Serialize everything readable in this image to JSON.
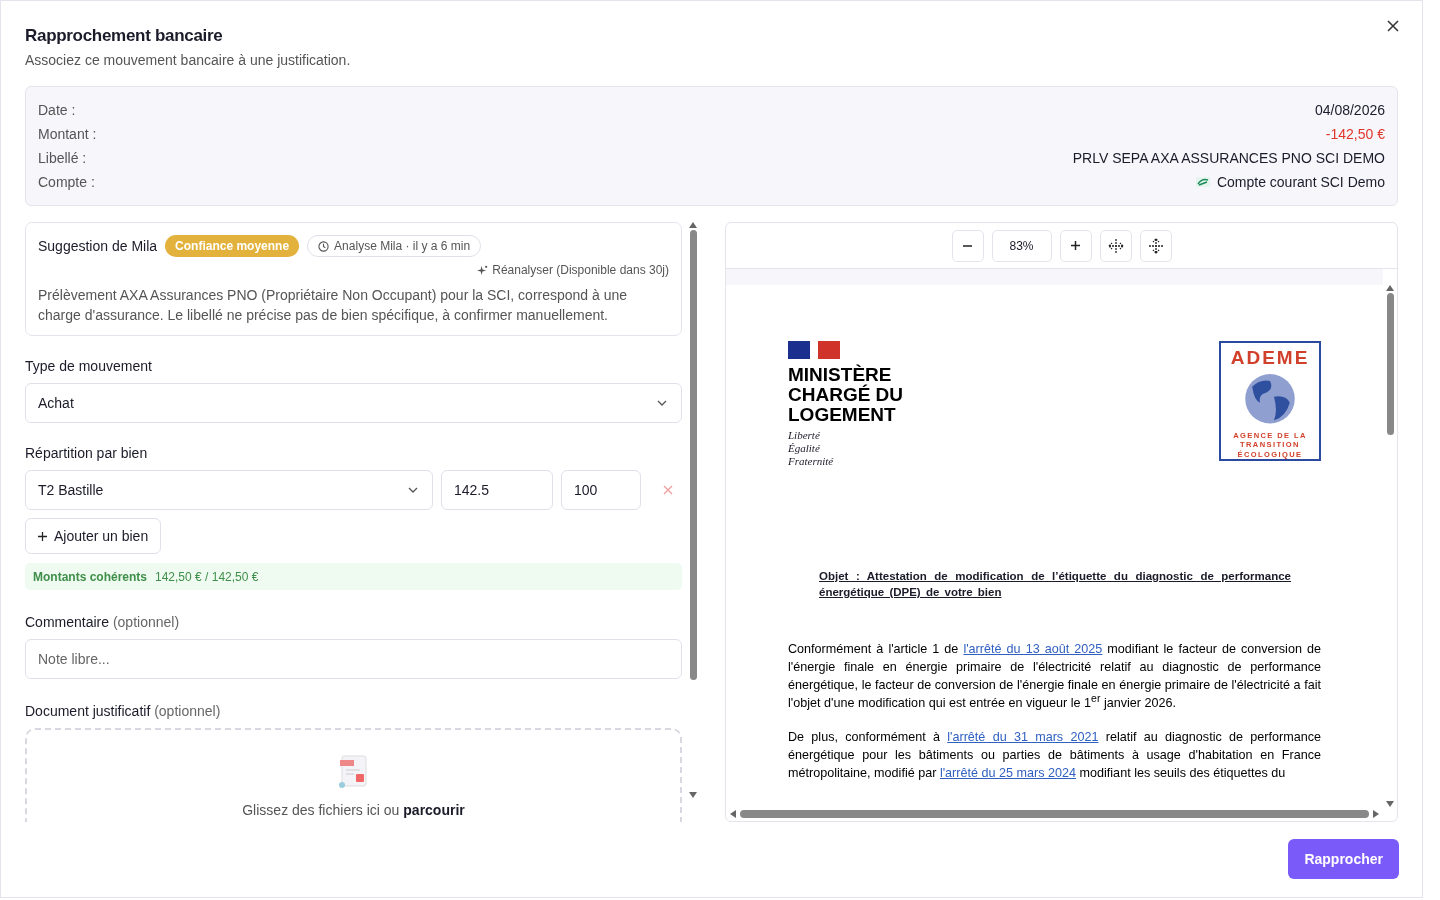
{
  "dialog": {
    "title": "Rapprochement bancaire",
    "subtitle": "Associez ce mouvement bancaire à une justification."
  },
  "transaction": [
    {
      "label": "Date :",
      "value": "04/08/2026",
      "kind": "text"
    },
    {
      "label": "Montant :",
      "value": "-142,50 €",
      "kind": "amount"
    },
    {
      "label": "Libellé :",
      "value": "PRLV SEPA AXA ASSURANCES PNO SCI DEMO",
      "kind": "text"
    },
    {
      "label": "Compte :",
      "value": "Compte courant SCI Demo",
      "kind": "account"
    }
  ],
  "suggestion": {
    "title": "Suggestion de Mila",
    "confidence": "Confiance moyenne",
    "analysis": "Analyse Mila · il y a 6 min",
    "reanalyze": "Réanalyser (Disponible dans 30j)",
    "text": "Prélèvement AXA Assurances PNO (Propriétaire Non Occupant) pour la SCI, correspond à une charge d'assurance. Le libellé ne précise pas de bien spécifique, à confirmer manuellement."
  },
  "movement_type": {
    "label": "Type de mouvement",
    "value": "Achat"
  },
  "allocation": {
    "label": "Répartition par bien",
    "rows": [
      {
        "property": "T2 Bastille",
        "amount": "142.5",
        "percent": "100"
      }
    ],
    "add_button": "Ajouter un bien",
    "status_label": "Montants cohérents",
    "status_value": "142,50 € / 142,50 €"
  },
  "comment": {
    "label": "Commentaire",
    "optional": "(optionnel)",
    "placeholder": "Note libre..."
  },
  "document": {
    "label": "Document justificatif",
    "optional": "(optionnel)",
    "drop_text": "Glissez des fichiers ici ou",
    "browse": "parcourir"
  },
  "viewer": {
    "zoom": "83%",
    "ministry": [
      "MINISTÈRE",
      "CHARGÉ DU",
      "LOGEMENT"
    ],
    "motto": [
      "Liberté",
      "Égalité",
      "Fraternité"
    ],
    "agency": "ADEME",
    "agency_sub": [
      "AGENCE DE LA",
      "TRANSITION",
      "ÉCOLOGIQUE"
    ],
    "subject": "Objet : Attestation de modification de l’étiquette du diagnostic de performance énergétique (DPE) de votre bien",
    "paragraphs": [
      [
        {
          "kind": "text",
          "text": "Conformément à l'article 1 de "
        },
        {
          "kind": "link",
          "text": "l'arrêté du 13 août 2025"
        },
        {
          "kind": "text",
          "text": " modifiant le facteur de conversion de l'énergie finale en énergie primaire de l'électricité relatif au diagnostic de performance énergétique, le facteur de conversion de l'énergie finale en énergie primaire de l'électricité a fait l'objet d'une modification qui est entrée en vigueur le 1$^{er}$ janvier 2026."
        }
      ],
      [
        {
          "kind": "text",
          "text": "De plus, conformément à "
        },
        {
          "kind": "link",
          "text": "l'arrêté du 31 mars 2021"
        },
        {
          "kind": "text",
          "text": " relatif au diagnostic de performance énergétique pour les bâtiments ou parties de bâtiments à usage d'habitation en France métropolitaine, modifié par "
        },
        {
          "kind": "link",
          "text": "l'arrêté du 25 mars 2024"
        },
        {
          "kind": "text",
          "text": " modifiant les seuils des étiquettes du"
        }
      ]
    ]
  },
  "submit": "Rapprocher"
}
